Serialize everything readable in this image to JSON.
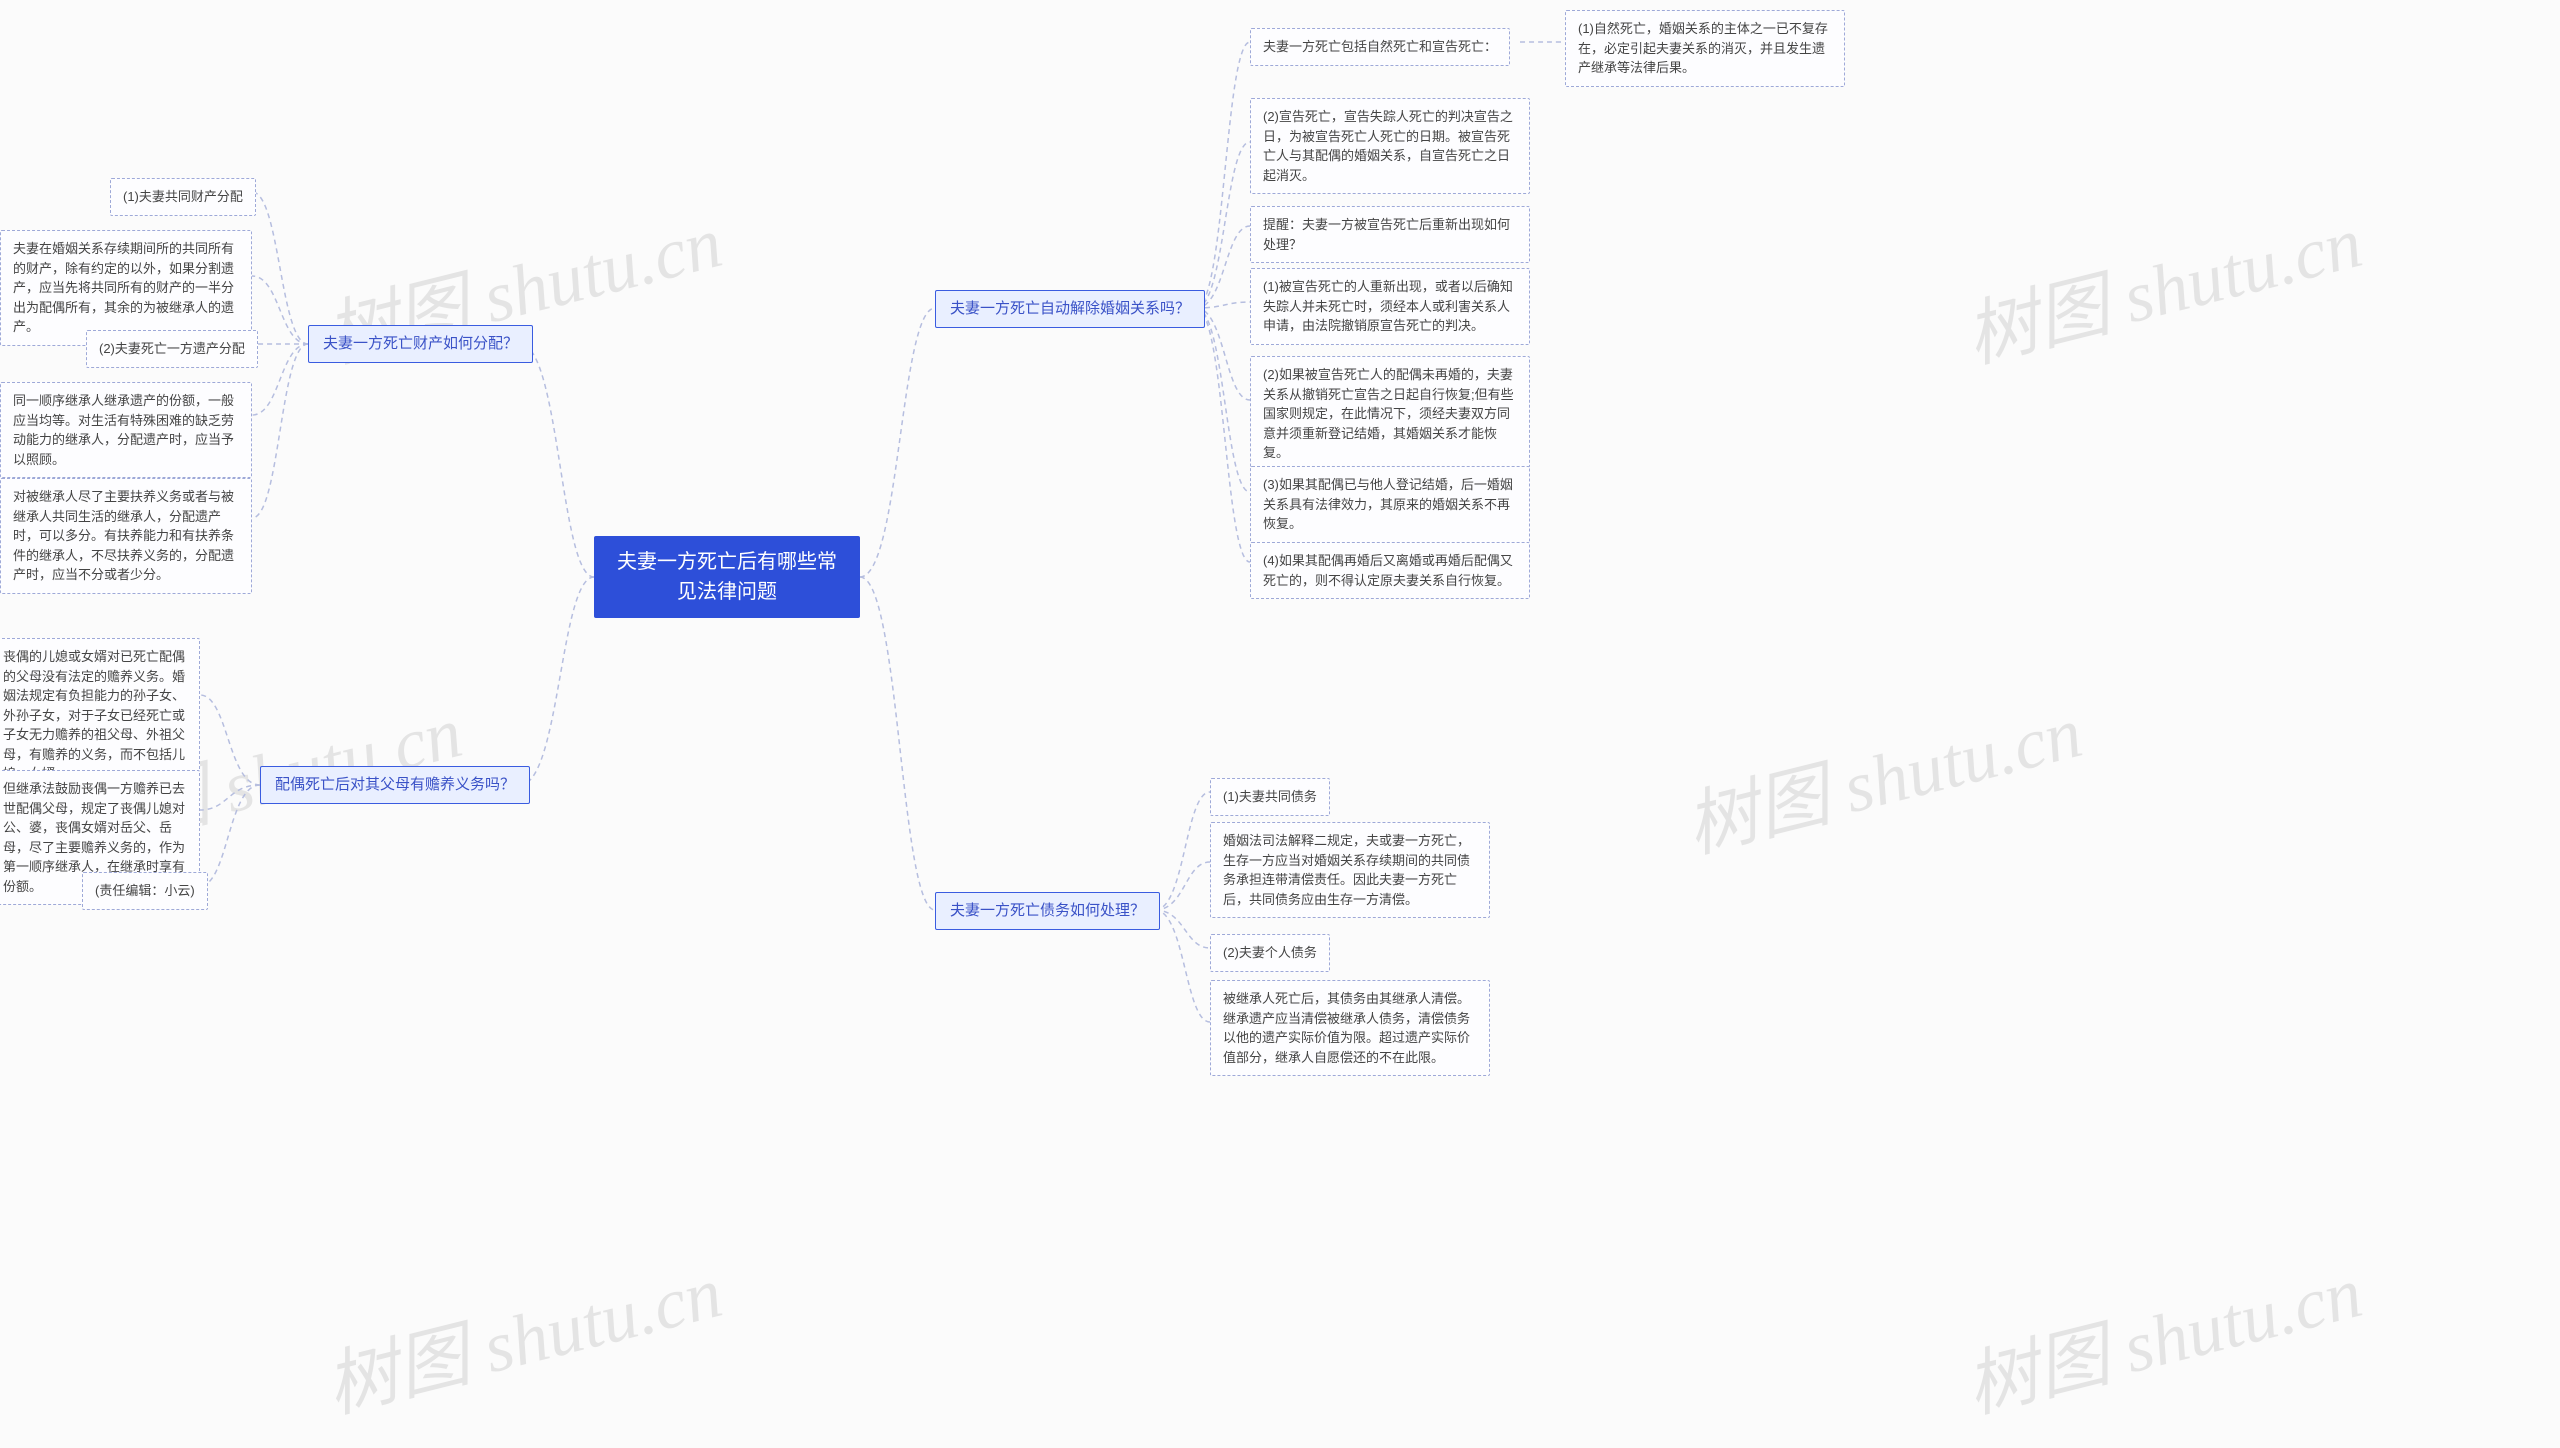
{
  "center": "夫妻一方死亡后有哪些常见法律问题",
  "branches": {
    "b1": "夫妻一方死亡财产如何分配？",
    "b2": "配偶死亡后对其父母有赡养义务吗？",
    "b3": "夫妻一方死亡自动解除婚姻关系吗？",
    "b4": "夫妻一方死亡债务如何处理？"
  },
  "leaves": {
    "l1a": "(1)夫妻共同财产分配",
    "l1b": "夫妻在婚姻关系存续期间所的共同所有的财产，除有约定的以外，如果分割遗产，应当先将共同所有的财产的一半分出为配偶所有，其余的为被继承人的遗产。",
    "l1c": "(2)夫妻死亡一方遗产分配",
    "l1d": "同一顺序继承人继承遗产的份额，一般应当均等。对生活有特殊困难的缺乏劳动能力的继承人，分配遗产时，应当予以照顾。",
    "l1e": "对被继承人尽了主要扶养义务或者与被继承人共同生活的继承人，分配遗产时，可以多分。有扶养能力和有扶养条件的继承人，不尽扶养义务的，分配遗产时，应当不分或者少分。",
    "l2a": "丧偶的儿媳或女婿对已死亡配偶的父母没有法定的赡养义务。婚姻法规定有负担能力的孙子女、外孙子女，对于子女已经死亡或子女无力赡养的祖父母、外祖父母，有赡养的义务，而不包括儿媳、女婿。",
    "l2b": "但继承法鼓励丧偶一方赡养已去世配偶父母，规定了丧偶儿媳对公、婆，丧偶女婿对岳父、岳母，尽了主要赡养义务的，作为第一顺序继承人，在继承时享有份额。",
    "l2c": "(责任编辑：小云)",
    "l3hdr": "夫妻一方死亡包括自然死亡和宣告死亡：",
    "l3a": "(1)自然死亡，婚姻关系的主体之一已不复存在，必定引起夫妻关系的消灭，并且发生遗产继承等法律后果。",
    "l3b": "(2)宣告死亡，宣告失踪人死亡的判决宣告之日，为被宣告死亡人死亡的日期。被宣告死亡人与其配偶的婚姻关系，自宣告死亡之日起消灭。",
    "l3c": "提醒：夫妻一方被宣告死亡后重新出现如何处理？",
    "l3d": "(1)被宣告死亡的人重新出现，或者以后确知失踪人并未死亡时，须经本人或利害关系人申请，由法院撤销原宣告死亡的判决。",
    "l3e": "(2)如果被宣告死亡人的配偶未再婚的，夫妻关系从撤销死亡宣告之日起自行恢复;但有些国家则规定，在此情况下，须经夫妻双方同意并须重新登记结婚，其婚姻关系才能恢复。",
    "l3f": "(3)如果其配偶已与他人登记结婚，后一婚姻关系具有法律效力，其原来的婚姻关系不再恢复。",
    "l3g": "(4)如果其配偶再婚后又离婚或再婚后配偶又死亡的，则不得认定原夫妻关系自行恢复。",
    "l4a": "(1)夫妻共同债务",
    "l4b": "婚姻法司法解释二规定，夫或妻一方死亡，生存一方应当对婚姻关系存续期间的共同债务承担连带清偿责任。因此夫妻一方死亡后，共同债务应由生存一方清偿。",
    "l4c": "(2)夫妻个人债务",
    "l4d": "被继承人死亡后，其债务由其继承人清偿。继承遗产应当清偿被继承人债务，清偿债务以他的遗产实际价值为限。超过遗产实际价值部分，继承人自愿偿还的不在此限。"
  },
  "watermark": "树图 shutu.cn"
}
